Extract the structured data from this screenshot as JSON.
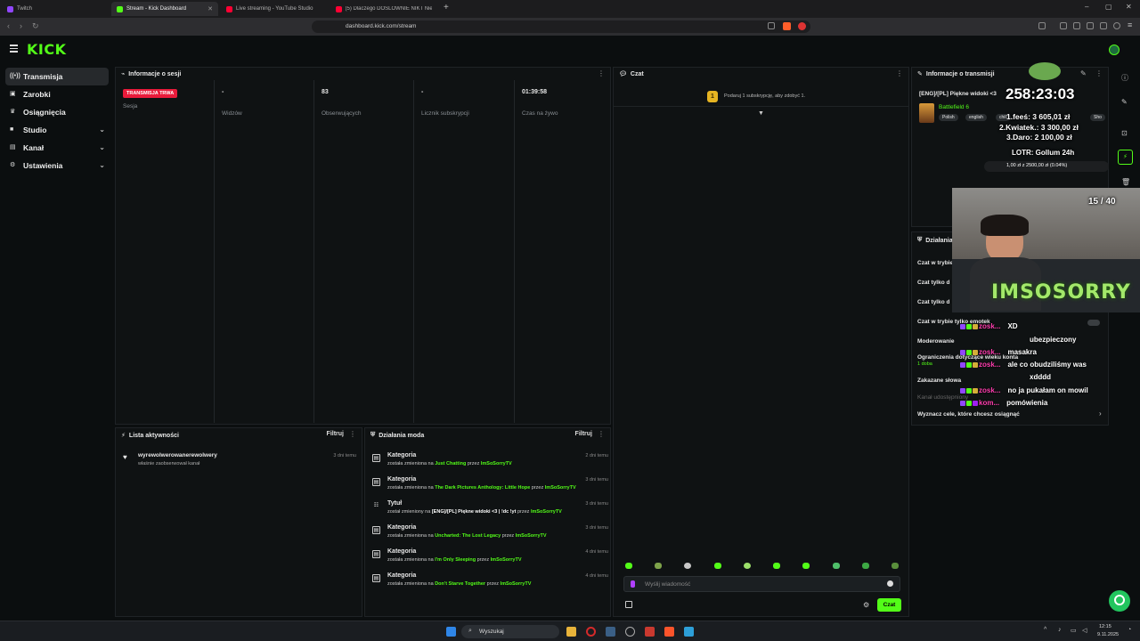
{
  "browser": {
    "tabs": [
      {
        "title": "Twitch"
      },
      {
        "title": "Stream - Kick Dashboard"
      },
      {
        "title": "Live streaming - YouTube Studio"
      },
      {
        "title": "(5) Dlaczego DOSLOWNIE NIKT Nie ..."
      }
    ],
    "url": "dashboard.kick.com/stream"
  },
  "header": {
    "logo": "KICK"
  },
  "sidebar": {
    "items": [
      {
        "label": "Transmisja"
      },
      {
        "label": "Zarobki"
      },
      {
        "label": "Osiągnięcia"
      },
      {
        "label": "Studio"
      },
      {
        "label": "Kanał"
      },
      {
        "label": "Ustawienia"
      }
    ]
  },
  "session": {
    "title": "Informacje o sesji",
    "badge": "TRANSMISJA TRWA",
    "badge_label": "Sesja",
    "stats": [
      {
        "value": "-",
        "label": "Widzów"
      },
      {
        "value": "83",
        "label": "Obserwujących"
      },
      {
        "value": "-",
        "label": "Licznik subskrypcji"
      },
      {
        "value": "01:39:58",
        "label": "Czas na żywo"
      }
    ]
  },
  "chat": {
    "title": "Czat",
    "gift_prompt": "Podaruj 1 subskrypcję, aby zdobyć 1.",
    "input_placeholder": "Wyślij wiadomość",
    "send_label": "Czat"
  },
  "stream_info": {
    "title": "Informacje o transmisji",
    "stream_title": "[ENG]/[PL] Piękne widoki <3",
    "category": "Battlefield 6",
    "tags": [
      "Polish",
      "english",
      "chill",
      "",
      "Sho"
    ]
  },
  "mod_settings": {
    "title": "Działania",
    "rows": [
      {
        "label": "Czat w trybie"
      },
      {
        "label": "Czat tylko d"
      },
      {
        "label": "Czat tylko d"
      },
      {
        "label": "Czat w trybie tylko emotek"
      },
      {
        "label": "Moderowanie"
      },
      {
        "label": "Ograniczenia dotyczące wieku konta",
        "sub": "1 doba"
      },
      {
        "label": "Zakazane słowa"
      },
      {
        "label": "Kanał udostępniony"
      },
      {
        "label": "Wyznacz cele, które chcesz osiągnąć"
      }
    ]
  },
  "activity": {
    "title": "Lista aktywności",
    "filter_label": "Filtruj",
    "items": [
      {
        "user": "wyrewolwerowanerewolwery",
        "text": "właśnie zaobserwował kanał",
        "time": "3 dni temu"
      }
    ]
  },
  "mod_actions": {
    "title": "Działania moda",
    "filter_label": "Filtruj",
    "items": [
      {
        "title": "Kategoria",
        "pre": "została zmieniona na",
        "value": "Just Chatting",
        "mid": "przez",
        "user": "ImSoSorryTV",
        "time": "2 dni temu"
      },
      {
        "title": "Kategoria",
        "pre": "została zmieniona na",
        "value": "The Dark Pictures Anthology: Little Hope",
        "mid": "przez",
        "user": "ImSoSorryTV",
        "time": "3 dni temu"
      },
      {
        "title": "Tytuł",
        "pre": "został zmieniony na",
        "value": "[ENG]/[PL] Piękne widoki <3 | !dc !yt",
        "mid": "przez",
        "user": "ImSoSorryTV",
        "time": "3 dni temu"
      },
      {
        "title": "Kategoria",
        "pre": "została zmieniona na",
        "value": "Uncharted: The Lost Legacy",
        "mid": "przez",
        "user": "ImSoSorryTV",
        "time": "3 dni temu"
      },
      {
        "title": "Kategoria",
        "pre": "została zmieniona na",
        "value": "I'm Only Sleeping",
        "mid": "przez",
        "user": "ImSoSorryTV",
        "time": "4 dni temu"
      },
      {
        "title": "Kategoria",
        "pre": "została zmieniona na",
        "value": "Don't Starve Together",
        "mid": "przez",
        "user": "ImSoSorryTV",
        "time": "4 dni temu"
      }
    ]
  },
  "overlay": {
    "timer": "258:23:03",
    "leaderboard": [
      "1.feeś: 3 605,01 zł",
      "2.Kwiatek.: 3 300,00 zł",
      "3.Daro: 2 100,00 zł"
    ],
    "goal_title": "LOTR: Gollum 24h",
    "goal_progress": "1,00 zł z 2500,00 zł (0.04%)",
    "goal_fraction": 0.0004,
    "counter": "15 / 40",
    "channel_name": "IMSOSORRY",
    "chat": [
      {
        "user": "zosk...",
        "msg": "XD"
      },
      {
        "user": "",
        "msg": "ubezpieczony"
      },
      {
        "user": "zosk...",
        "msg": "masakra"
      },
      {
        "user": "zosk...",
        "msg": "ale co obudziliśmy was"
      },
      {
        "user": "",
        "msg": "xdddd"
      },
      {
        "user": "zosk...",
        "msg": "no ja pukałam on mowil"
      },
      {
        "user": "kom...",
        "msg": "pomówienia"
      }
    ]
  },
  "taskbar": {
    "search": "Wyszukaj",
    "time": "12:15",
    "date": "9.11.2025"
  }
}
